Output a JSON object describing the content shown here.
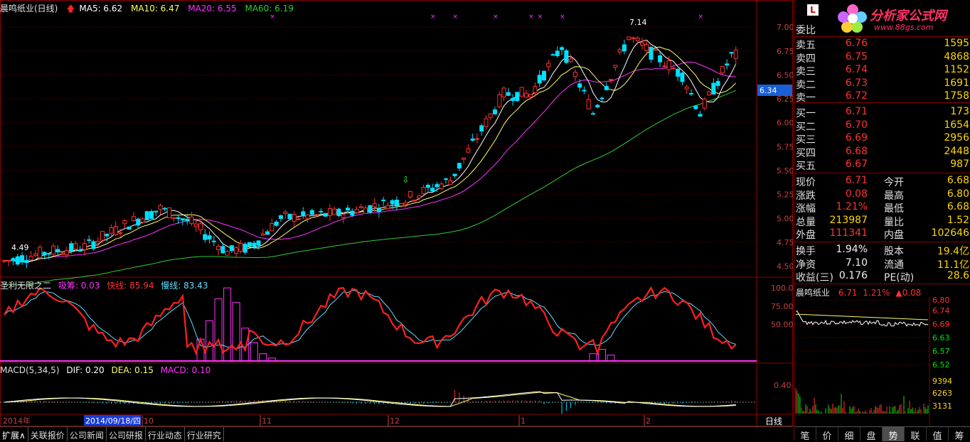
{
  "header": {
    "title": "晨鸣纸业(日线)",
    "ma5": "MA5: 6.62",
    "ma10": "MA10: 6.47",
    "ma20": "MA20: 6.55",
    "ma60": "MA60: 6.19"
  },
  "colors": {
    "up": "#ff3232",
    "down": "#00e0ff",
    "ma5": "#ffffff",
    "ma10": "#ffff66",
    "ma20": "#ff33ff",
    "ma60": "#33cc33",
    "grid": "#8b0000"
  },
  "price_axis": {
    "labels": [
      "7.00",
      "6.75",
      "6.50",
      "6.25",
      "6.00",
      "5.75",
      "5.50",
      "5.25",
      "5.00",
      "4.75",
      "4.50"
    ],
    "current_price_tag": "6.34",
    "high_annotation": "7.14",
    "low_annotation": "4.49"
  },
  "indicator1": {
    "name": "圣利无限之二",
    "xichou": "吸筹: 0.03",
    "kuaixian": "快线: 85.94",
    "manxian": "慢线: 83.43",
    "axis": [
      "100.0",
      "75.00",
      "50.00"
    ]
  },
  "indicator2": {
    "name": "MACD(5,34,5)",
    "dif": "DIF: 0.20",
    "dea": "DEA: 0.15",
    "macd": "MACD: 0.10",
    "axis": [
      "0.40"
    ]
  },
  "time_axis": {
    "year": "2014年",
    "selected_date": "2014/09/18/四",
    "months": [
      "10",
      "11",
      "12",
      "1",
      "2"
    ],
    "period": "日线"
  },
  "bottom_tabs": [
    "扩展∧",
    "关联报价",
    "公司新闻",
    "公司研报",
    "行业动态",
    "行业研究"
  ],
  "right_panel": {
    "logo_text": "分析家公式网",
    "logo_url": "www.88gs.com",
    "weibi_label": "委比",
    "sell": [
      {
        "label": "卖五",
        "price": "6.76",
        "vol": "1595"
      },
      {
        "label": "卖四",
        "price": "6.75",
        "vol": "4868"
      },
      {
        "label": "卖三",
        "price": "6.74",
        "vol": "1152"
      },
      {
        "label": "卖二",
        "price": "6.73",
        "vol": "1691"
      },
      {
        "label": "卖一",
        "price": "6.72",
        "vol": "1758"
      }
    ],
    "buy": [
      {
        "label": "买一",
        "price": "6.71",
        "vol": "173"
      },
      {
        "label": "买二",
        "price": "6.70",
        "vol": "1654"
      },
      {
        "label": "买三",
        "price": "6.69",
        "vol": "2956"
      },
      {
        "label": "买四",
        "price": "6.68",
        "vol": "2448"
      },
      {
        "label": "买五",
        "price": "6.67",
        "vol": "987"
      }
    ],
    "quote": [
      {
        "l1": "现价",
        "v1": "6.71",
        "l2": "今开",
        "v2": "6.68"
      },
      {
        "l1": "涨跌",
        "v1": "0.08",
        "l2": "最高",
        "v2": "6.80"
      },
      {
        "l1": "涨幅",
        "v1": "1.21%",
        "l2": "最低",
        "v2": "6.68"
      },
      {
        "l1": "总量",
        "v1": "213987",
        "l2": "量比",
        "v2": "1.52"
      },
      {
        "l1": "外盘",
        "v1": "111341",
        "l2": "内盘",
        "v2": "102646"
      }
    ],
    "fundamentals": [
      {
        "l1": "换手",
        "v1": "1.94%",
        "l2": "股本",
        "v2": "19.4亿"
      },
      {
        "l1": "净资",
        "v1": "7.10",
        "l2": "流通",
        "v2": "11.1亿"
      },
      {
        "l1": "收益(三)",
        "v1": "0.176",
        "l2": "PE(动)",
        "v2": "28.6"
      }
    ],
    "mini_chart": {
      "name": "晨鸣纸业",
      "price": "6.71",
      "pct": "1.21%",
      "change": "▲0.08",
      "axis": [
        "6.80",
        "6.74",
        "6.69",
        "6.63",
        "6.57",
        "6.52"
      ],
      "vol_axis": [
        "9394",
        "6263",
        "3131"
      ]
    },
    "tabs": [
      "笔",
      "价",
      "细",
      "盘",
      "势",
      "联",
      "值",
      "筹"
    ],
    "active_tab": "势"
  }
}
